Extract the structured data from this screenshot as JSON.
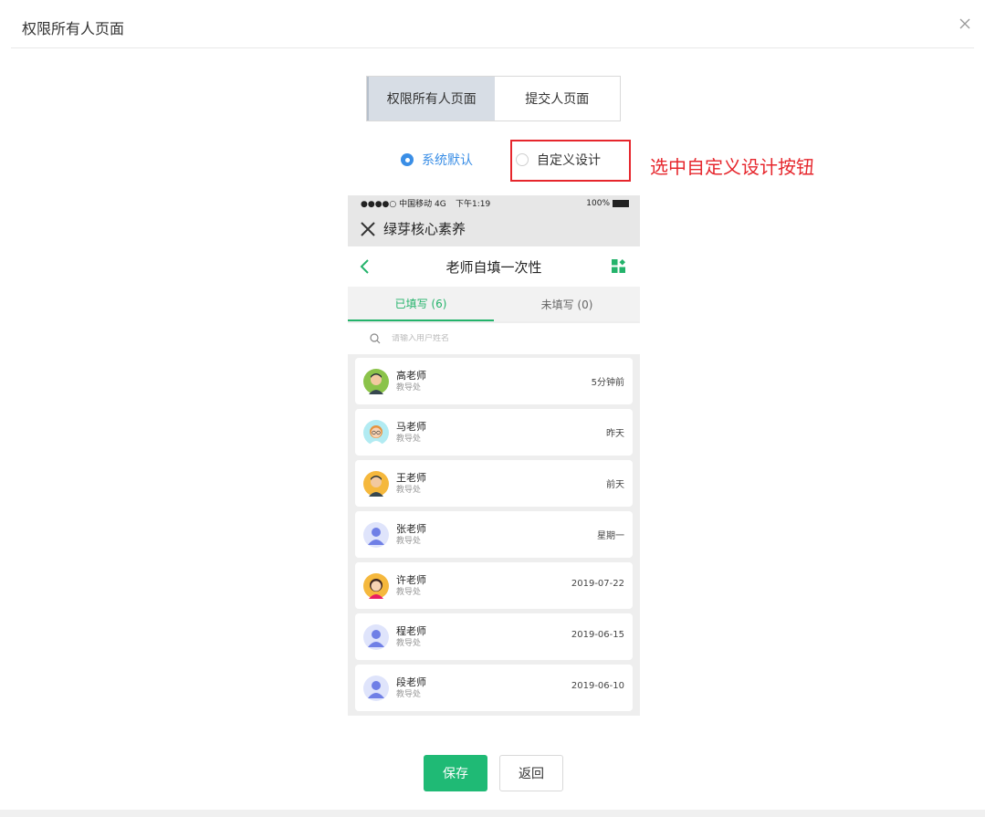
{
  "dialog": {
    "title": "权限所有人页面"
  },
  "tabs": [
    {
      "label": "权限所有人页面",
      "active": true
    },
    {
      "label": "提交人页面",
      "active": false
    }
  ],
  "radios": {
    "default_label": "系统默认",
    "custom_label": "自定义设计",
    "selected": "系统默认"
  },
  "annotation": "选中自定义设计按钮",
  "phone": {
    "status": {
      "carrier": "●●●●○ 中国移动 4G",
      "time": "下午1:19",
      "battery": "100%"
    },
    "app_title": "绿芽核心素养",
    "nav_title": "老师自填一次性",
    "sub_tabs": [
      {
        "label": "已填写 (6)",
        "active": true
      },
      {
        "label": "未填写 (0)",
        "active": false
      }
    ],
    "search_placeholder": "请输入用户姓名",
    "items": [
      {
        "name": "高老师",
        "dept": "教导处",
        "time": "5分钟前",
        "avatar": "male-green"
      },
      {
        "name": "马老师",
        "dept": "教导处",
        "time": "昨天",
        "avatar": "female-glasses"
      },
      {
        "name": "王老师",
        "dept": "教导处",
        "time": "前天",
        "avatar": "male-orange"
      },
      {
        "name": "张老师",
        "dept": "教导处",
        "time": "星期一",
        "avatar": "default-blue"
      },
      {
        "name": "许老师",
        "dept": "教导处",
        "time": "2019-07-22",
        "avatar": "female-orange"
      },
      {
        "name": "程老师",
        "dept": "教导处",
        "time": "2019-06-15",
        "avatar": "default-blue"
      },
      {
        "name": "段老师",
        "dept": "教导处",
        "time": "2019-06-10",
        "avatar": "default-blue"
      }
    ]
  },
  "buttons": {
    "save": "保存",
    "back": "返回"
  },
  "colors": {
    "accent_green": "#1fba75",
    "radio_blue": "#3a8ee6",
    "annotation_red": "#e6262c"
  }
}
